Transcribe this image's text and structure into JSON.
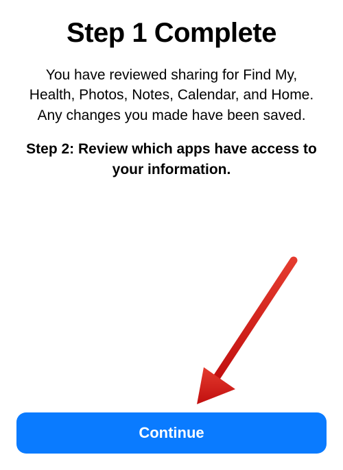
{
  "title": "Step 1 Complete",
  "body_paragraph": "You have reviewed sharing for Find My, Health, Photos, Notes, Calendar, and Home. Any changes you made have been saved.",
  "step2_paragraph": "Step 2: Review which apps have access to your information.",
  "continue_label": "Continue",
  "colors": {
    "primary_button": "#0a7bff",
    "annotation_arrow": "#d8201e"
  }
}
